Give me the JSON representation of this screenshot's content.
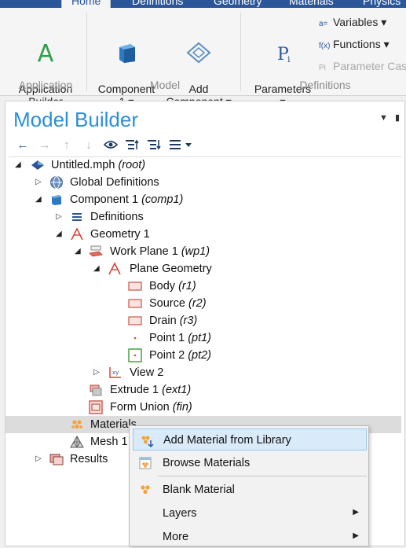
{
  "ribbon_tabs": [
    "Home",
    "Definitions",
    "Geometry",
    "Materials",
    "Physics"
  ],
  "ribbon": {
    "application": {
      "button": "Application\nBuilder",
      "group": "Application"
    },
    "model": {
      "component": "Component\n1 ▾",
      "add_component": "Add\nComponent ▾",
      "group": "Model"
    },
    "definitions": {
      "parameters": "Parameters\n▾",
      "variables": "Variables ▾",
      "functions": "Functions ▾",
      "parameter_case": "Parameter Cas",
      "group": "Definitions"
    }
  },
  "panel": {
    "title": "Model Builder"
  },
  "tree": {
    "root": {
      "name": "Untitled.mph",
      "tag": "(root)"
    },
    "global_definitions": "Global Definitions",
    "component": {
      "name": "Component 1",
      "tag": "(comp1)"
    },
    "definitions": "Definitions",
    "geometry": "Geometry 1",
    "work_plane": {
      "name": "Work Plane 1",
      "tag": "(wp1)"
    },
    "plane_geometry": "Plane Geometry",
    "body": {
      "name": "Body",
      "tag": "(r1)"
    },
    "source": {
      "name": "Source",
      "tag": "(r2)"
    },
    "drain": {
      "name": "Drain",
      "tag": "(r3)"
    },
    "point1": {
      "name": "Point 1",
      "tag": "(pt1)"
    },
    "point2": {
      "name": "Point 2",
      "tag": "(pt2)"
    },
    "view": "View 2",
    "extrude": {
      "name": "Extrude 1",
      "tag": "(ext1)"
    },
    "form_union": {
      "name": "Form Union",
      "tag": "(fin)"
    },
    "materials": "Materials",
    "mesh": "Mesh 1",
    "results": "Results"
  },
  "context_menu": {
    "add_from_library": "Add Material from Library",
    "browse": "Browse Materials",
    "blank": "Blank Material",
    "layers": "Layers",
    "more": "More"
  },
  "colors": {
    "accent": "#2b8fd6",
    "ribbon_blue": "#2b579a",
    "selected_row": "#dcdcdc",
    "menu_hover": "#d9eaf9"
  }
}
